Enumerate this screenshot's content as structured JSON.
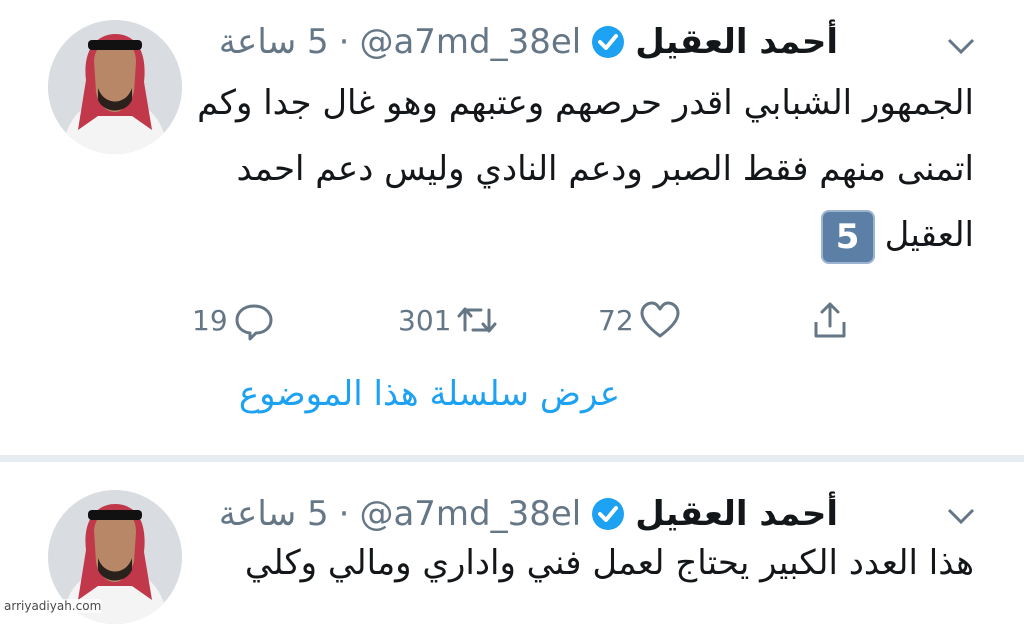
{
  "colors": {
    "link_blue": "#1da1f2",
    "secondary_text": "#657786",
    "divider": "#e6ecf0",
    "verified": "#1da1f2"
  },
  "tweets": [
    {
      "name": "أحمد العقيل",
      "handle": "@a7md_38el",
      "separator": "·",
      "time": "5 ساعة",
      "verified_icon": "verified-badge-icon",
      "lines": [
        "الجمهور الشبابي اقدر حرصهم وعتبهم وهو غال جدا وكم",
        "اتمنى منهم فقط الصبر ودعم النادي وليس دعم احمد",
        "العقيل"
      ],
      "emoji_keycap": "5",
      "actions": {
        "reply_count": "19",
        "retweet_count": "301",
        "like_count": "72"
      },
      "thread_link": "عرض سلسلة هذا الموضوع"
    },
    {
      "name": "أحمد العقيل",
      "handle": "@a7md_38el",
      "separator": "·",
      "time": "5 ساعة",
      "verified_icon": "verified-badge-icon",
      "lines": [
        "هذا العدد الكبير يحتاج لعمل فني واداري ومالي وكلي"
      ]
    }
  ],
  "watermark": "arriyadiyah.com"
}
